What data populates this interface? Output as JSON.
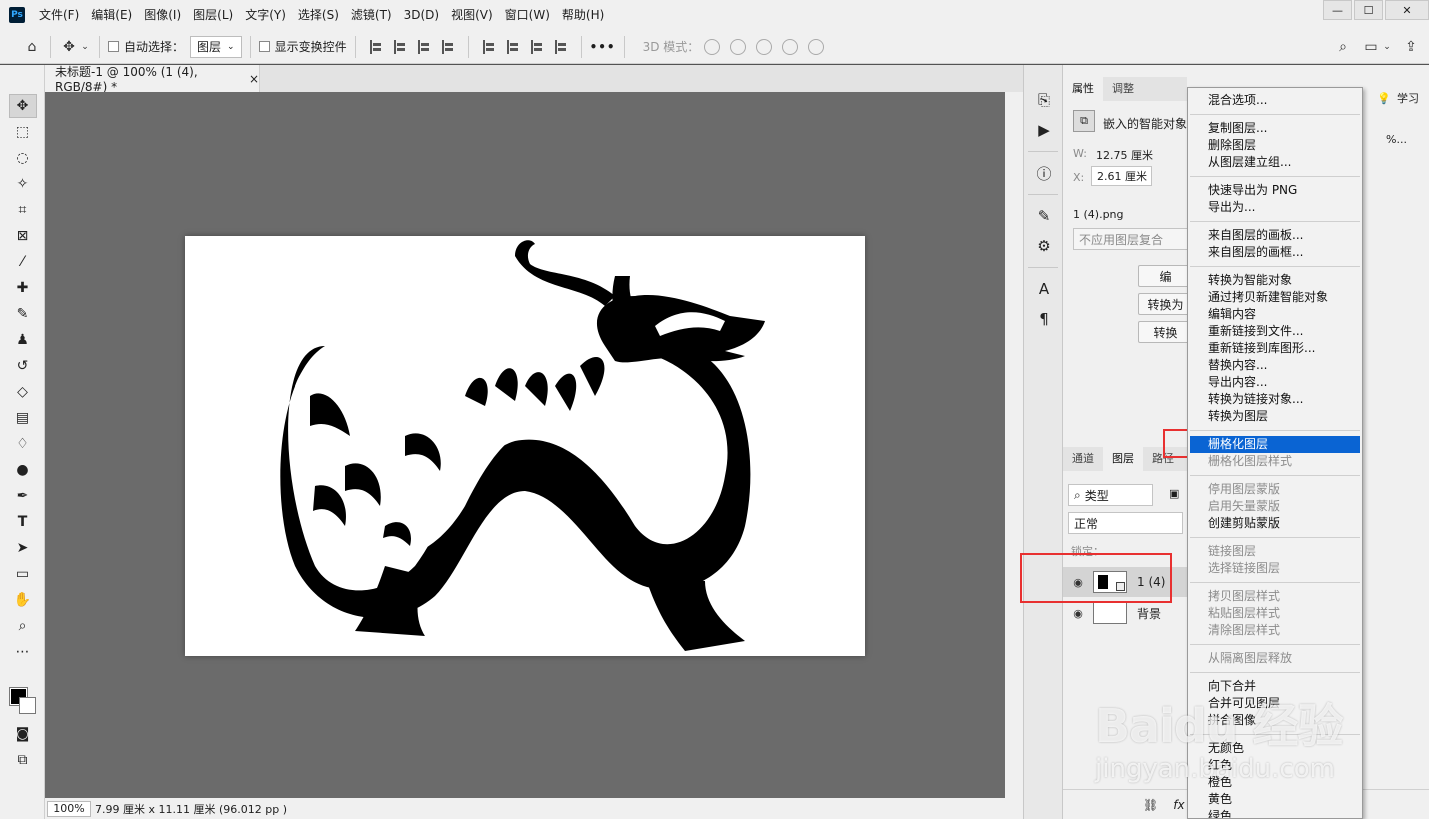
{
  "app": {
    "logo": "Ps"
  },
  "menubar": {
    "items": [
      "文件(F)",
      "编辑(E)",
      "图像(I)",
      "图层(L)",
      "文字(Y)",
      "选择(S)",
      "滤镜(T)",
      "3D(D)",
      "视图(V)",
      "窗口(W)",
      "帮助(H)"
    ]
  },
  "window_controls": {
    "minimize": "—",
    "maximize": "☐",
    "close": "✕"
  },
  "optionsbar": {
    "auto_select_label": "自动选择：",
    "auto_select_value": "图层",
    "show_transform_label": "显示变换控件",
    "more_label": "•••",
    "mode_3d_label": "3D 模式："
  },
  "document": {
    "tab_title": "未标题-1 @ 100% (1 (4), RGB/8#) *",
    "tab_close": "×",
    "zoom": "100%",
    "dimensions": "7.99 厘米 x 11.11 厘米 (96.012 pp )"
  },
  "properties": {
    "tabs": [
      "属性",
      "调整"
    ],
    "learn_tab": "学习",
    "object_type": "嵌入的智能对象",
    "w_label": "W:",
    "w_value": "12.75 厘米",
    "x_label": "X:",
    "x_value": "2.61 厘米",
    "file_name": "1 (4).png",
    "comp_placeholder": "不应用图层复合",
    "btn_edit": "编",
    "btn_convert1": "转换为",
    "btn_convert2": "转换",
    "percent": "%..."
  },
  "layers": {
    "tabs": [
      "通道",
      "图层",
      "路径"
    ],
    "filter_label": "类型",
    "blend_mode": "正常",
    "lock_label": "锁定：",
    "rows": [
      {
        "name": "1 (4)",
        "selected": true
      },
      {
        "name": "背景",
        "selected": false
      }
    ],
    "fx_label": "fx"
  },
  "context_menu": {
    "groups": [
      [
        {
          "label": "混合选项...",
          "disabled": false
        }
      ],
      [
        {
          "label": "复制图层...",
          "disabled": false
        },
        {
          "label": "删除图层",
          "disabled": false
        },
        {
          "label": "从图层建立组...",
          "disabled": false
        }
      ],
      [
        {
          "label": "快速导出为 PNG",
          "disabled": false
        },
        {
          "label": "导出为...",
          "disabled": false
        }
      ],
      [
        {
          "label": "来自图层的画板...",
          "disabled": false
        },
        {
          "label": "来自图层的画框...",
          "disabled": false
        }
      ],
      [
        {
          "label": "转换为智能对象",
          "disabled": false
        },
        {
          "label": "通过拷贝新建智能对象",
          "disabled": false
        },
        {
          "label": "编辑内容",
          "disabled": false
        },
        {
          "label": "重新链接到文件...",
          "disabled": false
        },
        {
          "label": "重新链接到库图形...",
          "disabled": false
        },
        {
          "label": "替换内容...",
          "disabled": false
        },
        {
          "label": "导出内容...",
          "disabled": false
        },
        {
          "label": "转换为链接对象...",
          "disabled": false
        },
        {
          "label": "转换为图层",
          "disabled": false
        }
      ],
      [
        {
          "label": "栅格化图层",
          "disabled": false,
          "highlighted": true
        },
        {
          "label": "栅格化图层样式",
          "disabled": true
        }
      ],
      [
        {
          "label": "停用图层蒙版",
          "disabled": true
        },
        {
          "label": "启用矢量蒙版",
          "disabled": true
        },
        {
          "label": "创建剪贴蒙版",
          "disabled": false
        }
      ],
      [
        {
          "label": "链接图层",
          "disabled": true
        },
        {
          "label": "选择链接图层",
          "disabled": true
        }
      ],
      [
        {
          "label": "拷贝图层样式",
          "disabled": true
        },
        {
          "label": "粘贴图层样式",
          "disabled": true
        },
        {
          "label": "清除图层样式",
          "disabled": true
        }
      ],
      [
        {
          "label": "从隔离图层释放",
          "disabled": true
        }
      ],
      [
        {
          "label": "向下合并",
          "disabled": false
        },
        {
          "label": "合并可见图层",
          "disabled": false
        },
        {
          "label": "拼合图像",
          "disabled": false
        }
      ],
      [
        {
          "label": "无颜色",
          "disabled": false
        },
        {
          "label": "红色",
          "disabled": false
        },
        {
          "label": "橙色",
          "disabled": false
        },
        {
          "label": "黄色",
          "disabled": false
        },
        {
          "label": "绿色",
          "disabled": false
        }
      ]
    ]
  },
  "watermark": {
    "brand": "Baidu 经验",
    "url": "jingyan.baidu.com"
  },
  "colors": {
    "highlight": "#0a64d3",
    "annotation": "#e83030",
    "canvas_bg": "#6b6b6b"
  }
}
